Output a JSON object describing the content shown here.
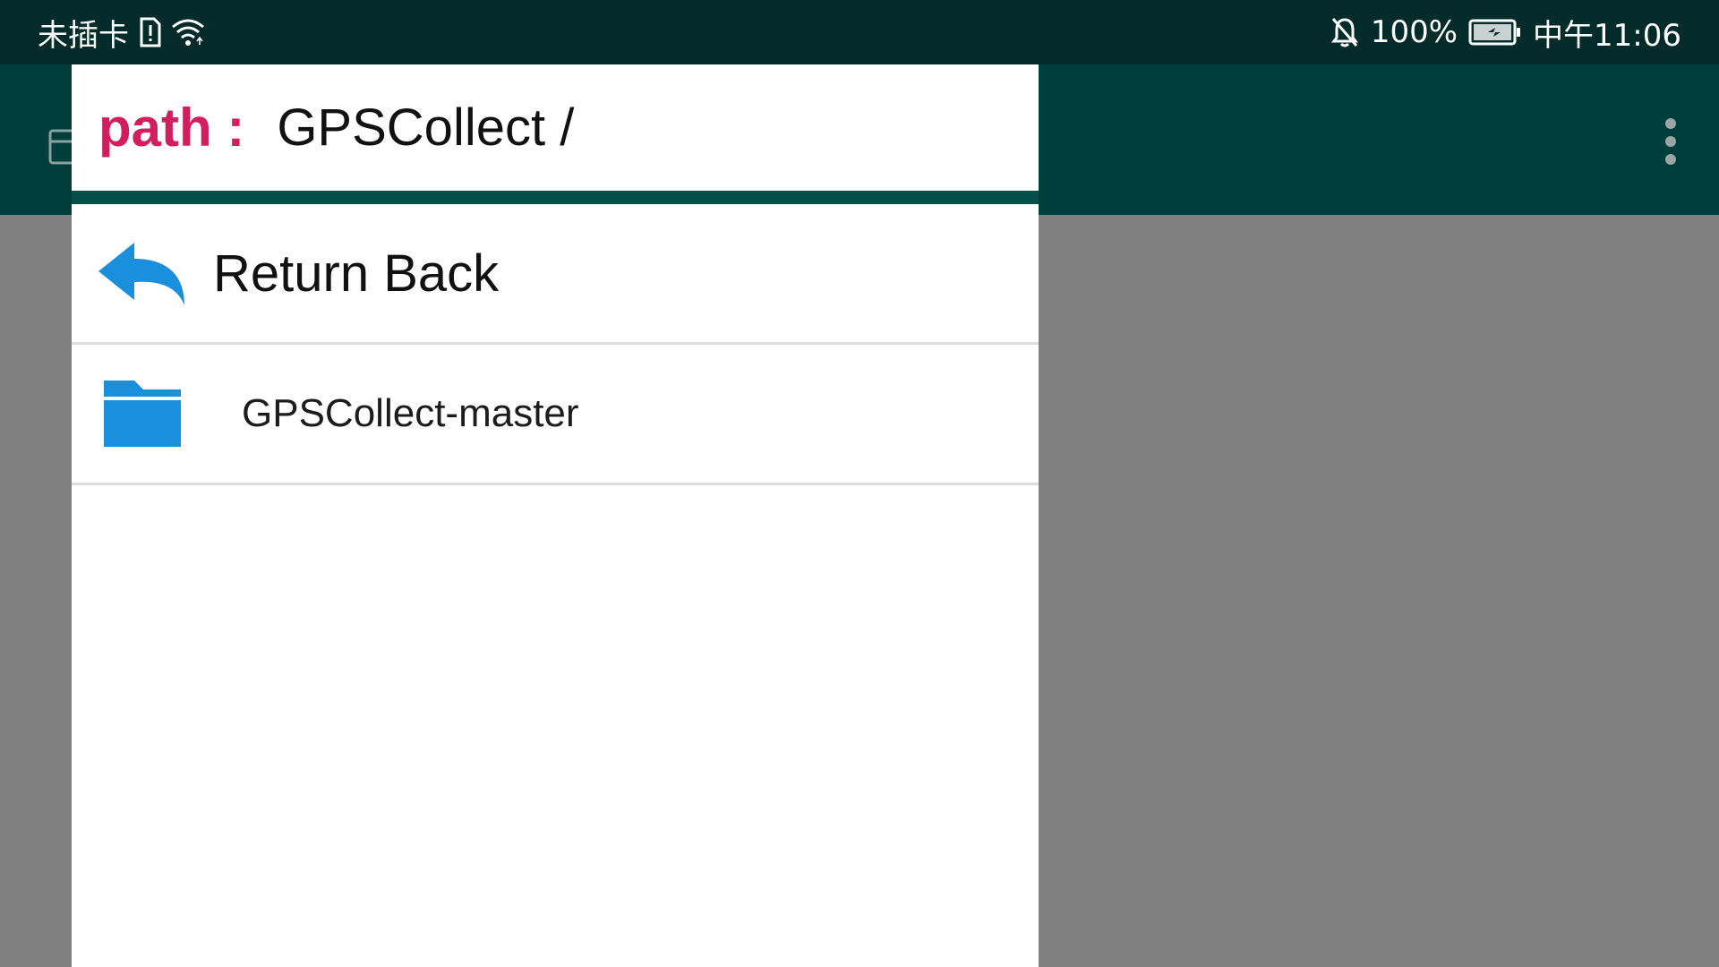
{
  "status_bar": {
    "carrier": "未插卡",
    "battery_percent": "100%",
    "time": "中午11:06",
    "icons": [
      "sim-alert-icon",
      "wifi-icon",
      "bell-off-icon",
      "battery-charging-icon"
    ]
  },
  "app_bar": {
    "icons": [
      "app-logo-icon",
      "overflow-menu-icon"
    ]
  },
  "dialog": {
    "path_label": "path :",
    "path_value": "GPSCollect /",
    "items": [
      {
        "label": "Return Back",
        "icon": "return-arrow-icon"
      },
      {
        "label": "GPSCollect-master",
        "icon": "folder-icon"
      }
    ]
  },
  "colors": {
    "status_bar": "#022b2a",
    "app_bar": "#003e3c",
    "scrim": "#808080",
    "path_label": "#d21e5c",
    "divider": "#025047",
    "icon_blue": "#1a8fdb"
  }
}
